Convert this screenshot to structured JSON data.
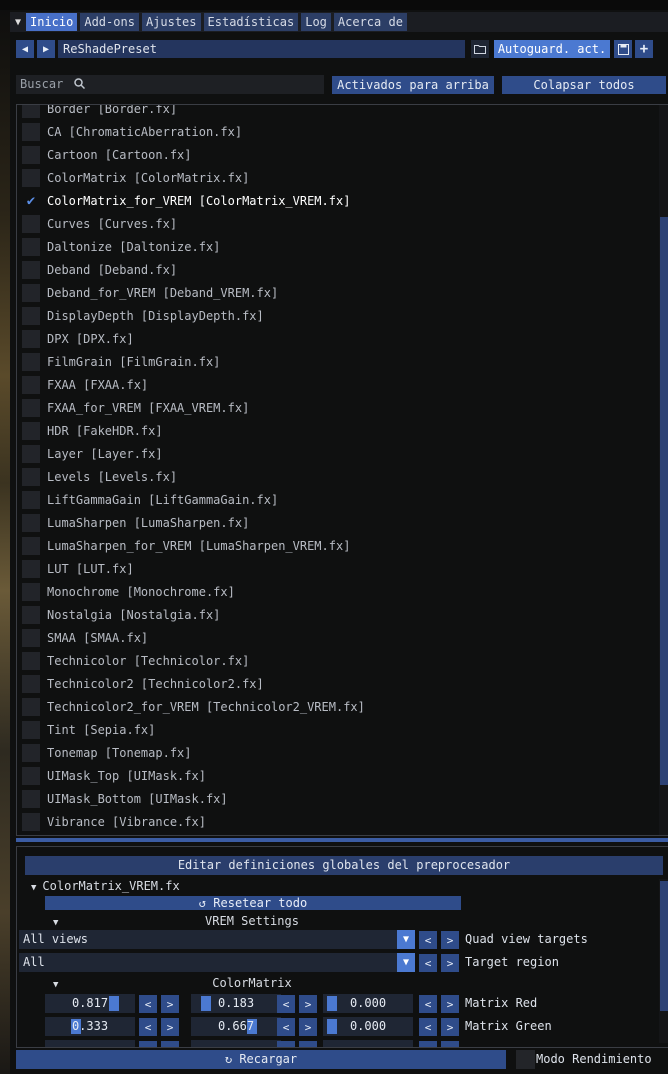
{
  "menu": {
    "tabs": [
      "Inicio",
      "Add-ons",
      "Ajustes",
      "Estadísticas",
      "Log",
      "Acerca de"
    ],
    "active": "Inicio"
  },
  "preset": {
    "name": "ReShadePreset",
    "autosave_label": "Autoguard. act."
  },
  "search": {
    "placeholder": "Buscar",
    "active_first_label": "Activados para arriba",
    "collapse_all_label": "Colapsar todos"
  },
  "effects": [
    {
      "label": "Border [Border.fx]",
      "checked": false
    },
    {
      "label": "CA [ChromaticAberration.fx]",
      "checked": false
    },
    {
      "label": "Cartoon [Cartoon.fx]",
      "checked": false
    },
    {
      "label": "ColorMatrix [ColorMatrix.fx]",
      "checked": false
    },
    {
      "label": "ColorMatrix_for_VREM [ColorMatrix_VREM.fx]",
      "checked": true
    },
    {
      "label": "Curves [Curves.fx]",
      "checked": false
    },
    {
      "label": "Daltonize [Daltonize.fx]",
      "checked": false
    },
    {
      "label": "Deband [Deband.fx]",
      "checked": false
    },
    {
      "label": "Deband_for_VREM [Deband_VREM.fx]",
      "checked": false
    },
    {
      "label": "DisplayDepth [DisplayDepth.fx]",
      "checked": false
    },
    {
      "label": "DPX [DPX.fx]",
      "checked": false
    },
    {
      "label": "FilmGrain [FilmGrain.fx]",
      "checked": false
    },
    {
      "label": "FXAA [FXAA.fx]",
      "checked": false
    },
    {
      "label": "FXAA_for_VREM [FXAA_VREM.fx]",
      "checked": false
    },
    {
      "label": "HDR [FakeHDR.fx]",
      "checked": false
    },
    {
      "label": "Layer [Layer.fx]",
      "checked": false
    },
    {
      "label": "Levels [Levels.fx]",
      "checked": false
    },
    {
      "label": "LiftGammaGain [LiftGammaGain.fx]",
      "checked": false
    },
    {
      "label": "LumaSharpen [LumaSharpen.fx]",
      "checked": false
    },
    {
      "label": "LumaSharpen_for_VREM [LumaSharpen_VREM.fx]",
      "checked": false
    },
    {
      "label": "LUT [LUT.fx]",
      "checked": false
    },
    {
      "label": "Monochrome [Monochrome.fx]",
      "checked": false
    },
    {
      "label": "Nostalgia [Nostalgia.fx]",
      "checked": false
    },
    {
      "label": "SMAA [SMAA.fx]",
      "checked": false
    },
    {
      "label": "Technicolor [Technicolor.fx]",
      "checked": false
    },
    {
      "label": "Technicolor2 [Technicolor2.fx]",
      "checked": false
    },
    {
      "label": "Technicolor2_for_VREM [Technicolor2_VREM.fx]",
      "checked": false
    },
    {
      "label": "Tint [Sepia.fx]",
      "checked": false
    },
    {
      "label": "Tonemap [Tonemap.fx]",
      "checked": false
    },
    {
      "label": "UIMask_Top [UIMask.fx]",
      "checked": false
    },
    {
      "label": "UIMask_Bottom [UIMask.fx]",
      "checked": false
    },
    {
      "label": "Vibrance [Vibrance.fx]",
      "checked": false
    }
  ],
  "editor": {
    "preprocessor_label": "Editar definiciones globales del preprocesador",
    "effect_name": "ColorMatrix_VREM.fx",
    "reset_label": "Resetear todo",
    "vrem_section": "VREM Settings",
    "quad_view": {
      "value": "All views",
      "label": "Quad view targets"
    },
    "target_region": {
      "value": "All",
      "label": "Target region"
    },
    "colormatrix_section": "ColorMatrix",
    "matrix_red": {
      "values": [
        "0.817",
        "0.183",
        "0.000"
      ],
      "label": "Matrix Red"
    },
    "matrix_green": {
      "values": [
        "0.333",
        "0.667",
        "0.000"
      ],
      "label": "Matrix Green"
    }
  },
  "footer": {
    "reload_label": "Recargar",
    "performance_label": "Modo Rendimiento"
  }
}
